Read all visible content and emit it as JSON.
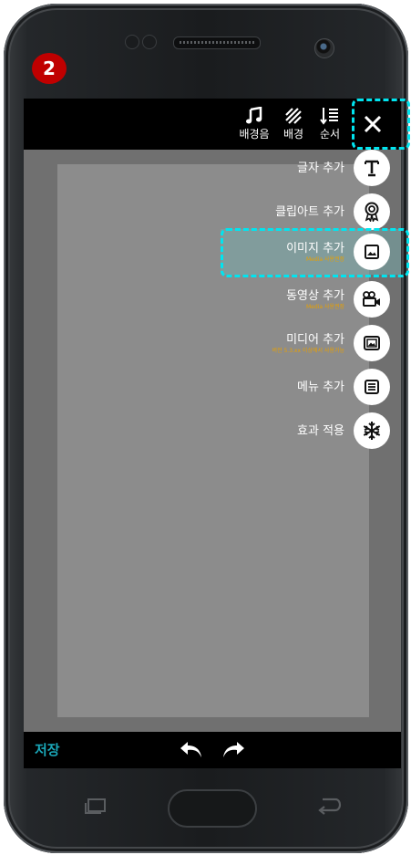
{
  "step_badge": "2",
  "toolbar": {
    "items": [
      {
        "label": "배경음",
        "icon": "music-note-icon"
      },
      {
        "label": "배경",
        "icon": "background-stripes-icon"
      },
      {
        "label": "순서",
        "icon": "sort-order-icon"
      }
    ],
    "close_icon": "close-icon"
  },
  "fab_menu": {
    "items": [
      {
        "label": "글자 추가",
        "sub": "",
        "icon": "text-icon"
      },
      {
        "label": "클립아트 추가",
        "sub": "",
        "icon": "clipart-badge-icon"
      },
      {
        "label": "이미지 추가",
        "sub": "Media 사용권장",
        "icon": "image-icon",
        "highlighted": true
      },
      {
        "label": "동영상 추가",
        "sub": "Media 사용권장",
        "icon": "video-camera-icon"
      },
      {
        "label": "미디어 추가",
        "sub": "버전 5.3.xx 이상에서 사용가능",
        "icon": "media-icon"
      },
      {
        "label": "메뉴 추가",
        "sub": "",
        "icon": "menu-list-icon"
      },
      {
        "label": "효과 적용",
        "sub": "",
        "icon": "snowflake-icon"
      }
    ]
  },
  "bottom_bar": {
    "save_label": "저장",
    "undo_icon": "undo-icon",
    "redo_icon": "redo-icon"
  },
  "colors": {
    "highlight_dash": "#00e5f0",
    "badge": "#c00000",
    "save": "#1aa7b8",
    "sub_text": "#e8a000"
  }
}
